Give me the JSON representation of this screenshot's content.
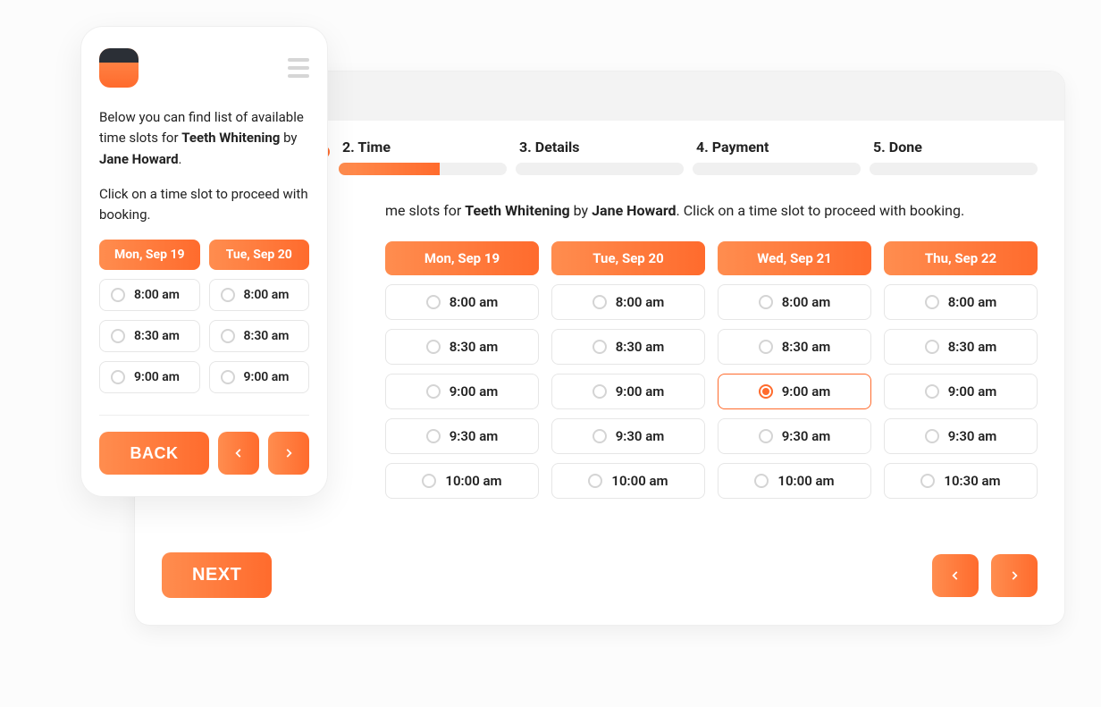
{
  "service": "Teeth Whitening",
  "staff": "Jane Howard",
  "steps": [
    {
      "label": "",
      "state": "done"
    },
    {
      "label": "2. Time",
      "state": "active"
    },
    {
      "label": "3. Details",
      "state": "pending"
    },
    {
      "label": "4. Payment",
      "state": "pending"
    },
    {
      "label": "5. Done",
      "state": "pending"
    }
  ],
  "desktop": {
    "desc_mid": "me slots for ",
    "desc_by": " by ",
    "desc_tail": ". Click on a time slot to proceed with booking.",
    "days": [
      {
        "label": "Mon, Sep 19",
        "slots": [
          "8:00 am",
          "8:30 am",
          "9:00 am",
          "9:30 am",
          "10:00 am"
        ]
      },
      {
        "label": "Tue, Sep 20",
        "slots": [
          "8:00 am",
          "8:30 am",
          "9:00 am",
          "9:30 am",
          "10:00 am"
        ]
      },
      {
        "label": "Wed, Sep 21",
        "slots": [
          "8:00 am",
          "8:30 am",
          "9:00 am",
          "9:30 am",
          "10:00 am"
        ],
        "selected": "9:00 am"
      },
      {
        "label": "Thu, Sep 22",
        "slots": [
          "8:00 am",
          "8:30 am",
          "9:00 am",
          "9:30 am",
          "10:30 am"
        ]
      }
    ],
    "next_label": "NEXT"
  },
  "mobile": {
    "desc_1": "Below you can find list of available time slots for ",
    "desc_by": " by ",
    "desc_period": ".",
    "desc_2": "Click on a time slot to proceed with booking.",
    "days": [
      {
        "label": "Mon, Sep 19",
        "slots": [
          "8:00 am",
          "8:30 am",
          "9:00 am"
        ]
      },
      {
        "label": "Tue, Sep 20",
        "slots": [
          "8:00 am",
          "8:30 am",
          "9:00 am"
        ]
      }
    ],
    "back_label": "BACK"
  },
  "icons": {
    "prev": "chevron-left-icon",
    "next": "chevron-right-icon"
  }
}
